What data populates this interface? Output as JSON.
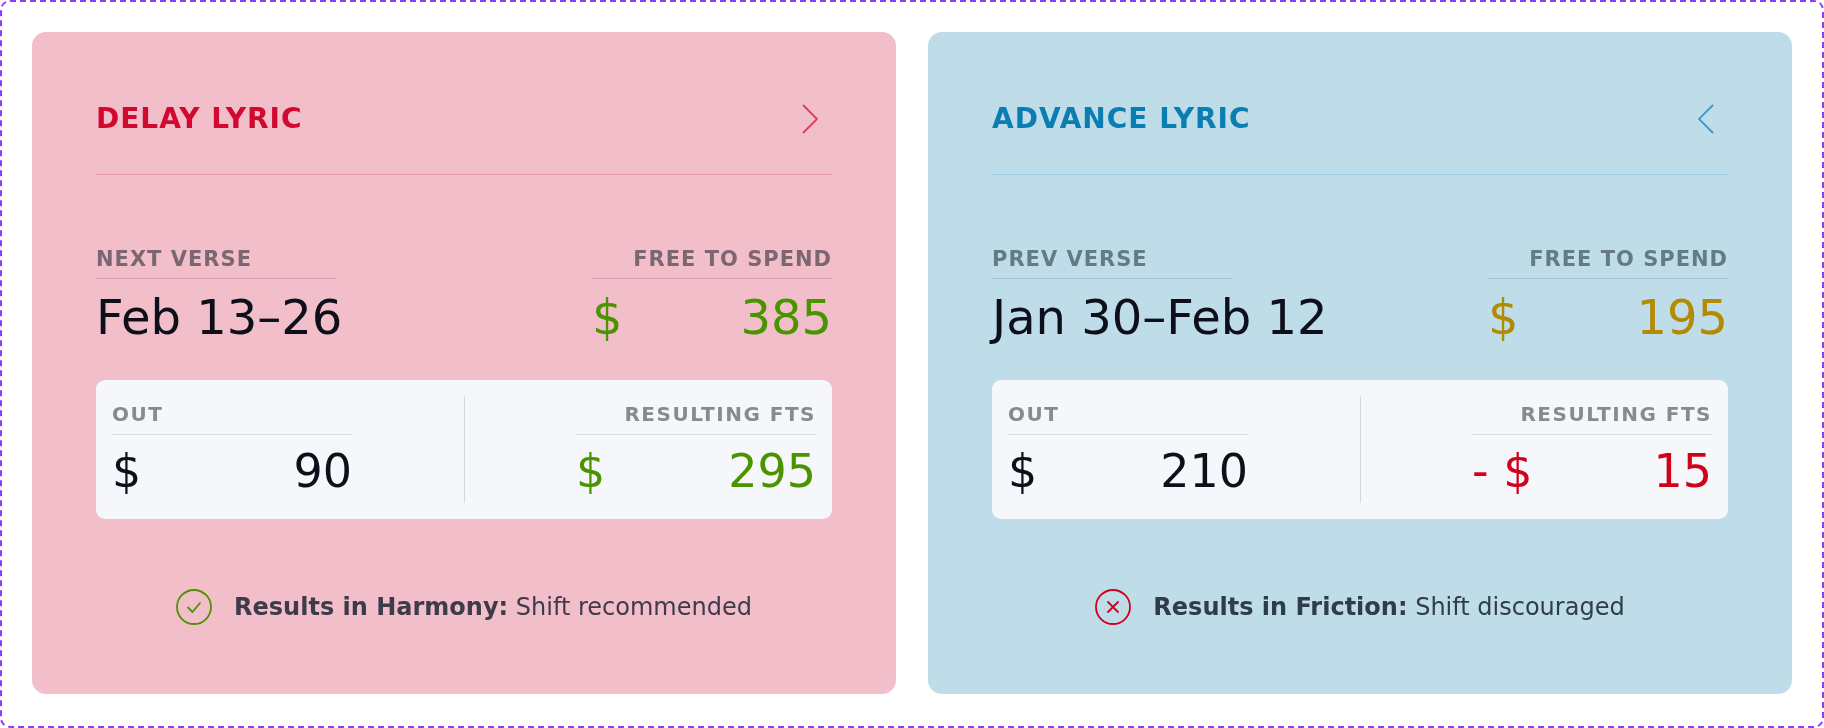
{
  "cards": [
    {
      "kind": "delay",
      "title": "DELAY LYRIC",
      "period": {
        "label": "NEXT VERSE",
        "value": "Feb 13–26"
      },
      "free_to_spend": {
        "label": "FREE TO SPEND",
        "prefix": "$",
        "value": "385",
        "color": "#4a9400"
      },
      "breakdown": [
        {
          "label": "OUT",
          "prefix": "$",
          "value": "90",
          "color": "#0d0f1a"
        },
        {
          "label": "RESULTING FTS",
          "prefix": "$",
          "value": "295",
          "color": "#4a9400"
        }
      ],
      "status": {
        "kind": "positive",
        "text": "**Results in Harmony:** Shift recommended"
      }
    },
    {
      "kind": "advance",
      "title": "ADVANCE LYRIC",
      "period": {
        "label": "PREV VERSE",
        "value": "Jan 30–Feb 12"
      },
      "free_to_spend": {
        "label": "FREE TO SPEND",
        "prefix": "$",
        "value": "195",
        "color": "#b38b00"
      },
      "breakdown": [
        {
          "label": "OUT",
          "prefix": "$",
          "value": "210",
          "color": "#0d0f1a"
        },
        {
          "label": "RESULTING FTS",
          "prefix": "- $",
          "value": "15",
          "color": "#d0021b"
        }
      ],
      "status": {
        "kind": "negative",
        "text": "**Results in Friction:** Shift discouraged"
      }
    }
  ]
}
